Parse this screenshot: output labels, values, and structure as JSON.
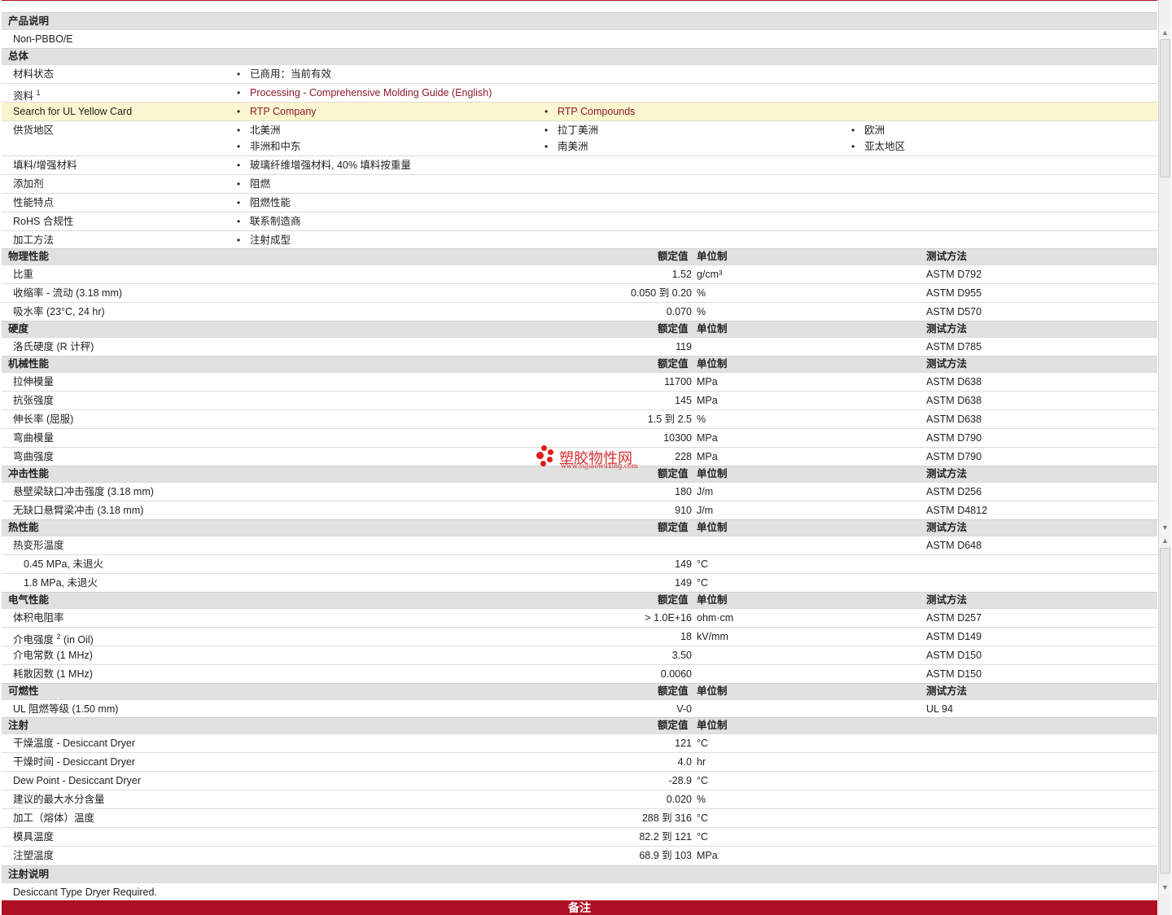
{
  "sections": {
    "product": {
      "title": "产品说明",
      "desc": "Non-PBBO/E"
    },
    "general": {
      "title": "总体",
      "material_status_label": "材料状态",
      "material_status": "已商用：当前有效",
      "docs_label": "资料",
      "docs_sup": "1",
      "docs_link": "Processing - Comprehensive Molding Guide (English)",
      "ul_label": "Search for UL Yellow Card",
      "ul_link1": "RTP Company",
      "ul_link2": "RTP Compounds",
      "region_label": "供货地区",
      "regions": [
        "北美洲",
        "拉丁美洲",
        "欧洲",
        "非洲和中东",
        "南美洲",
        "亚太地区"
      ],
      "filler_label": "填料/增强材料",
      "filler": "玻璃纤维增强材料, 40% 填料按重量",
      "additive_label": "添加剂",
      "additive": "阻燃",
      "feature_label": "性能特点",
      "feature": "阻燃性能",
      "rohs_label": "RoHS 合规性",
      "rohs": "联系制造商",
      "process_label": "加工方法",
      "process": "注射成型"
    },
    "hdr": {
      "nominal": "额定值",
      "unit": "单位制",
      "method": "测试方法"
    },
    "physical": {
      "title": "物理性能",
      "rows": [
        {
          "name": "比重",
          "value": "1.52",
          "unit": "g/cm³",
          "method": "ASTM D792"
        },
        {
          "name": "收缩率  - 流动  (3.18 mm)",
          "value": "0.050 到  0.20",
          "unit": "%",
          "method": "ASTM D955"
        },
        {
          "name": "吸水率  (23°C, 24 hr)",
          "value": "0.070",
          "unit": "%",
          "method": "ASTM D570"
        }
      ]
    },
    "hardness": {
      "title": "硬度",
      "rows": [
        {
          "name": "洛氏硬度  (R 计秤)",
          "value": "119",
          "unit": "",
          "method": "ASTM D785"
        }
      ]
    },
    "mechanical": {
      "title": "机械性能",
      "rows": [
        {
          "name": "拉伸模量",
          "value": "11700",
          "unit": "MPa",
          "method": "ASTM D638"
        },
        {
          "name": "抗张强度",
          "value": "145",
          "unit": "MPa",
          "method": "ASTM D638"
        },
        {
          "name": "伸长率  (屈服)",
          "value": "1.5 到  2.5",
          "unit": "%",
          "method": "ASTM D638"
        },
        {
          "name": "弯曲模量",
          "value": "10300",
          "unit": "MPa",
          "method": "ASTM D790"
        },
        {
          "name": "弯曲强度",
          "value": "228",
          "unit": "MPa",
          "method": "ASTM D790"
        }
      ]
    },
    "impact": {
      "title": "冲击性能",
      "rows": [
        {
          "name": "悬壁梁缺口冲击强度  (3.18 mm)",
          "value": "180",
          "unit": "J/m",
          "method": "ASTM D256"
        },
        {
          "name": "无缺口悬臂梁冲击  (3.18 mm)",
          "value": "910",
          "unit": "J/m",
          "method": "ASTM D4812"
        }
      ]
    },
    "thermal": {
      "title": "热性能",
      "rows": [
        {
          "name": "热变形温度",
          "value": "",
          "unit": "",
          "method": "ASTM D648"
        },
        {
          "name": "0.45 MPa, 未退火",
          "value": "149",
          "unit": "°C",
          "method": ""
        },
        {
          "name": "1.8 MPa, 未退火",
          "value": "149",
          "unit": "°C",
          "method": ""
        }
      ]
    },
    "electrical": {
      "title": "电气性能",
      "rows": [
        {
          "name": "体积电阻率",
          "value": "> 1.0E+16",
          "unit": "ohm·cm",
          "method": "ASTM D257"
        },
        {
          "name": "介电强度",
          "sup": "2",
          "suffix": "(in Oil)",
          "value": "18",
          "unit": "kV/mm",
          "method": "ASTM D149"
        },
        {
          "name": "介电常数  (1 MHz)",
          "value": "3.50",
          "unit": "",
          "method": "ASTM D150"
        },
        {
          "name": "耗散因数  (1 MHz)",
          "value": "0.0060",
          "unit": "",
          "method": "ASTM D150"
        }
      ]
    },
    "flammability": {
      "title": "可燃性",
      "rows": [
        {
          "name": "UL 阻燃等级  (1.50 mm)",
          "value": "V-0",
          "unit": "",
          "method": "UL 94"
        }
      ]
    },
    "injection": {
      "title": "注射",
      "rows": [
        {
          "name": "干燥温度  - Desiccant Dryer",
          "value": "121",
          "unit": "°C",
          "method": ""
        },
        {
          "name": "干燥时间  - Desiccant Dryer",
          "value": "4.0",
          "unit": "hr",
          "method": ""
        },
        {
          "name": "Dew Point - Desiccant Dryer",
          "value": "-28.9",
          "unit": "°C",
          "method": ""
        },
        {
          "name": "建议的最大水分含量",
          "value": "0.020",
          "unit": "%",
          "method": ""
        },
        {
          "name": "加工（熔体）温度",
          "value": "288 到  316",
          "unit": "°C",
          "method": ""
        },
        {
          "name": "模具温度",
          "value": "82.2 到  121",
          "unit": "°C",
          "method": ""
        },
        {
          "name": "注塑温度",
          "value": "68.9 到  103",
          "unit": "MPa",
          "method": ""
        }
      ]
    },
    "injection_notes": {
      "title": "注射说明",
      "text": "Desiccant Type Dryer Required."
    }
  },
  "footer": {
    "label": "备注"
  },
  "watermark": {
    "cn": "塑胶物性网",
    "en": "www.sujiaowuxing.com"
  },
  "colors": {
    "accent": "#b01023",
    "link": "#8b1a2b",
    "section_bg": "#e1e1e1",
    "highlight_bg": "#fbf6cf"
  }
}
